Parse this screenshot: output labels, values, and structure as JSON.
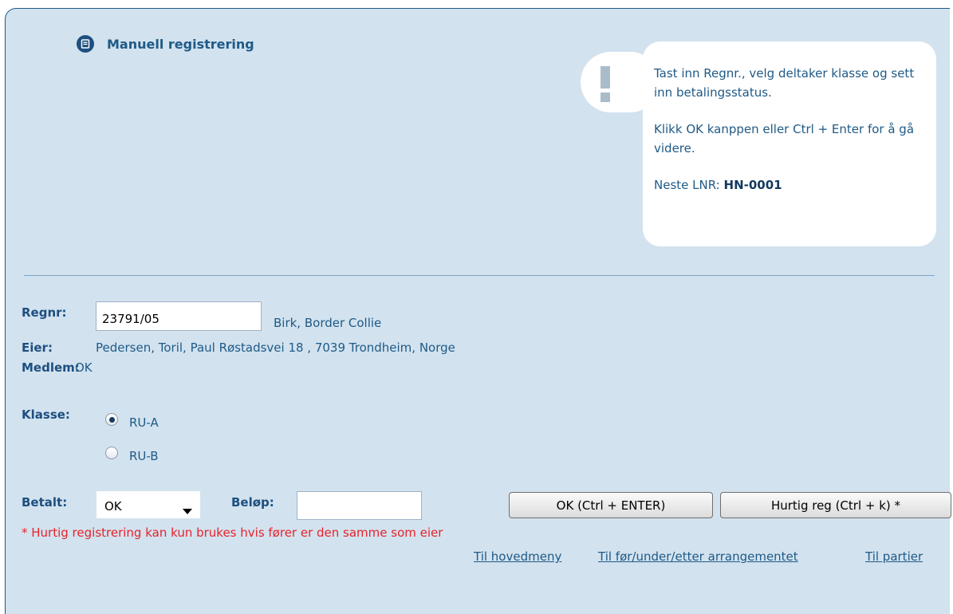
{
  "header": {
    "title": "Manuell registrering"
  },
  "help": {
    "line1": "Tast inn Regnr., velg deltaker klasse og sett inn betalingsstatus.",
    "line2": "Klikk OK kanppen eller Ctrl + Enter for å gå videre.",
    "next_label": "Neste LNR: ",
    "next_value": "HN-0001"
  },
  "form": {
    "regnr_label": "Regnr:",
    "regnr_value": "23791/05",
    "dog_name": "Birk, Border Collie",
    "eier_label": "Eier:",
    "eier_value": "Pedersen, Toril, Paul Røstadsvei 18 , 7039 Trondheim, Norge",
    "medlem_label": "Medlem:",
    "medlem_value": "OK",
    "klasse_label": "Klasse:",
    "klasse_options": [
      {
        "label": "RU-A",
        "selected": true
      },
      {
        "label": "RU-B",
        "selected": false
      }
    ],
    "betalt_label": "Betalt:",
    "betalt_value": "OK",
    "belop_label": "Beløp:",
    "belop_value": ""
  },
  "buttons": {
    "ok": "OK (Ctrl + ENTER)",
    "hurtig": "Hurtig reg (Ctrl + k) *"
  },
  "note": "* Hurtig registrering kan kun brukes hvis fører er den samme som eier",
  "links": {
    "hovedmeny": "Til hovedmeny",
    "arrangement": "Til før/under/etter arrangementet",
    "partier": "Til partier"
  },
  "colors": {
    "panel_bg": "#d2e2ef",
    "text": "#1f5a86",
    "note": "#e8232a"
  }
}
